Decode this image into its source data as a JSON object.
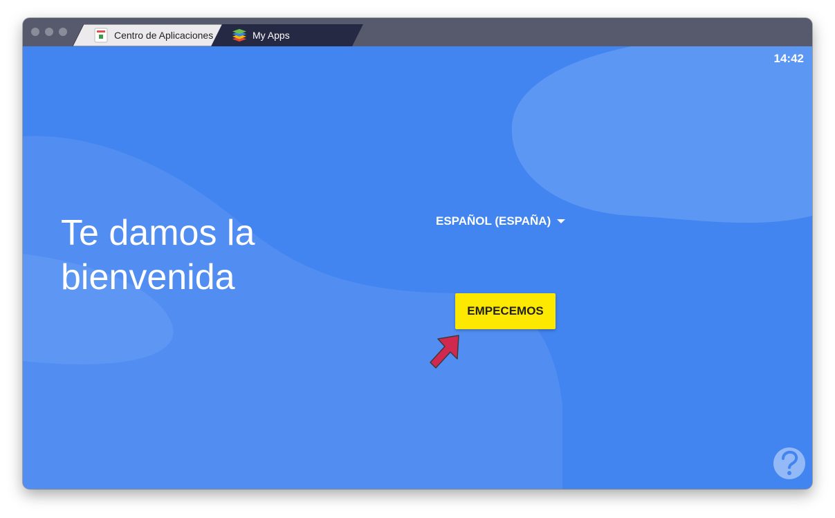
{
  "window": {
    "tabs": [
      {
        "label": "Centro de Aplicaciones",
        "icon": "app-center-icon"
      },
      {
        "label": "My Apps",
        "icon": "bluestacks-icon"
      }
    ]
  },
  "status_bar": {
    "time": "14:42"
  },
  "welcome": {
    "title_line1": "Te damos la",
    "title_line2": "bienvenida",
    "language": "ESPAÑOL (ESPAÑA)",
    "start_button": "EMPECEMOS"
  },
  "colors": {
    "background": "#4285f0",
    "button": "#fde800",
    "arrow": "#d0284f"
  }
}
